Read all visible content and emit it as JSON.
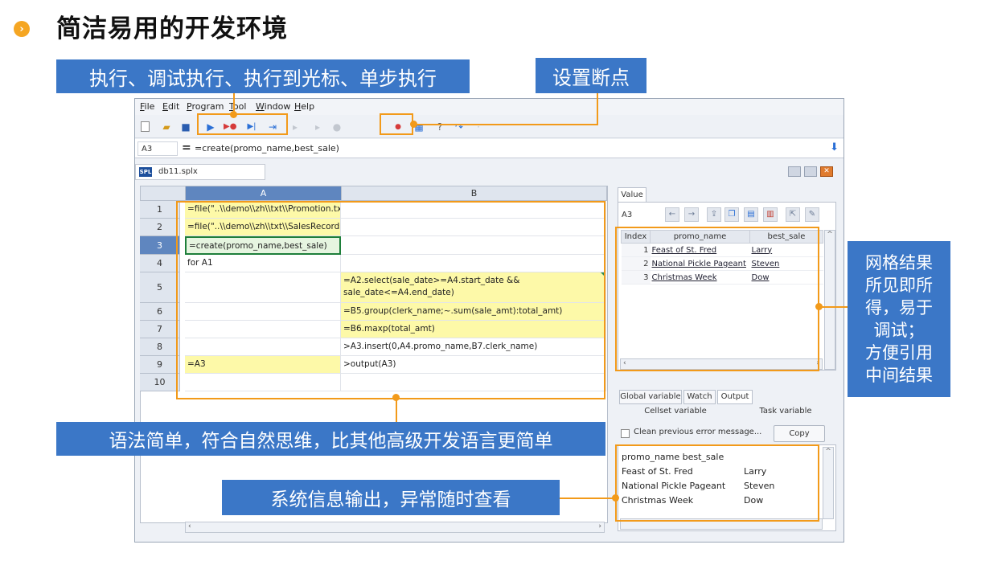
{
  "slide": {
    "title": "简洁易用的开发环境",
    "bullet_icon": "chevron-right-icon"
  },
  "callouts": {
    "exec": "执行、调试执行、执行到光标、单步执行",
    "breakpoint": "设置断点",
    "grid_result": "网格结果所见即所得，易于调试；方便引用中间结果",
    "grid_result_lines": [
      "网格结果",
      "所见即所",
      "得，易于",
      "调试；",
      "方便引用",
      "中间结果"
    ],
    "syntax": "语法简单，符合自然思维，比其他高级开发语言更简单",
    "sysinfo": "系统信息输出，异常随时查看"
  },
  "menu": [
    "File",
    "Edit",
    "Program",
    "Tool",
    "Window",
    "Help"
  ],
  "formula_bar": {
    "cell": "A3",
    "eq": "=",
    "formula": "=create(promo_name,best_sale)"
  },
  "doc_tab": {
    "badge": "SPL",
    "name": "db11.splx"
  },
  "grid": {
    "columns": [
      "A",
      "B"
    ],
    "rows": [
      {
        "n": "1",
        "a": "=file(\"..\\\\demo\\\\zh\\\\txt\\\\Promotion.txt\").import@t()",
        "b": ""
      },
      {
        "n": "2",
        "a": "=file(\"..\\\\demo\\\\zh\\\\txt\\\\SalesRecord.txt\").import@t()",
        "b": ""
      },
      {
        "n": "3",
        "a": "=create(promo_name,best_sale)",
        "b": ""
      },
      {
        "n": "4",
        "a": "for A1",
        "b": ""
      },
      {
        "n": "5",
        "a": "",
        "b": "=A2.select(sale_date>=A4.start_date &&",
        "b2": "sale_date<=A4.end_date)"
      },
      {
        "n": "6",
        "a": "",
        "b": "=B5.group(clerk_name;~.sum(sale_amt):total_amt)"
      },
      {
        "n": "7",
        "a": "",
        "b": "=B6.maxp(total_amt)"
      },
      {
        "n": "8",
        "a": "",
        "b": ">A3.insert(0,A4.promo_name,B7.clerk_name)"
      },
      {
        "n": "9",
        "a": "=A3",
        "b": ">output(A3)"
      },
      {
        "n": "10",
        "a": "",
        "b": ""
      }
    ]
  },
  "value_panel": {
    "tab": "Value",
    "cell": "A3",
    "headers": [
      "Index",
      "promo_name",
      "best_sale"
    ],
    "rows": [
      {
        "i": "1",
        "p": "Feast of St. Fred",
        "b": "Larry"
      },
      {
        "i": "2",
        "p": "National Pickle Pageant",
        "b": "Steven"
      },
      {
        "i": "3",
        "p": "Christmas Week",
        "b": "Dow"
      }
    ]
  },
  "var_tabs": [
    "Global variable",
    "Watch",
    "Output"
  ],
  "var_subtabs": [
    "Cellset variable",
    "Task variable"
  ],
  "output_panel": {
    "clear_label": "Clean previous error message...",
    "copy_label": "Copy",
    "lines": [
      [
        "promo_name best_sale",
        ""
      ],
      [
        "Feast of St. Fred",
        "Larry"
      ],
      [
        "National Pickle Pageant",
        "Steven"
      ],
      [
        "Christmas Week",
        "Dow"
      ]
    ]
  },
  "colors": {
    "callout_bg": "#3b77c7",
    "annotation": "#f29a1a",
    "selected_header": "#5f86bf",
    "yellow_cell": "#fdf9a8"
  }
}
